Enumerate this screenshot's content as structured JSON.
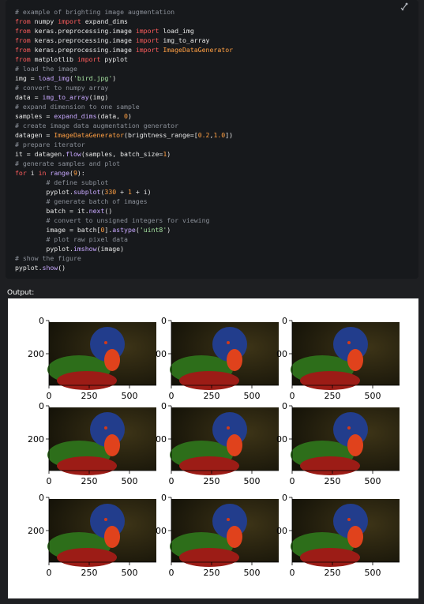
{
  "code": {
    "lines": [
      [
        {
          "t": "# example of brighting image augmentation",
          "c": "comment"
        }
      ],
      [
        {
          "t": "from",
          "c": "keyword"
        },
        {
          "t": " numpy ",
          "c": "default"
        },
        {
          "t": "import",
          "c": "keyword"
        },
        {
          "t": " expand_dims",
          "c": "default"
        }
      ],
      [
        {
          "t": "from",
          "c": "keyword"
        },
        {
          "t": " keras.preprocessing.image ",
          "c": "default"
        },
        {
          "t": "import",
          "c": "keyword"
        },
        {
          "t": " load_img",
          "c": "default"
        }
      ],
      [
        {
          "t": "from",
          "c": "keyword"
        },
        {
          "t": " keras.preprocessing.image ",
          "c": "default"
        },
        {
          "t": "import",
          "c": "keyword"
        },
        {
          "t": " img_to_array",
          "c": "default"
        }
      ],
      [
        {
          "t": "from",
          "c": "keyword"
        },
        {
          "t": " keras.preprocessing.image ",
          "c": "default"
        },
        {
          "t": "import",
          "c": "keyword"
        },
        {
          "t": " ImageDataGenerator",
          "c": "class"
        }
      ],
      [
        {
          "t": "from",
          "c": "keyword"
        },
        {
          "t": " matplotlib ",
          "c": "default"
        },
        {
          "t": "import",
          "c": "keyword"
        },
        {
          "t": " pyplot",
          "c": "default"
        }
      ],
      [
        {
          "t": "# load the image",
          "c": "comment"
        }
      ],
      [
        {
          "t": "img = ",
          "c": "default"
        },
        {
          "t": "load_img",
          "c": "function"
        },
        {
          "t": "(",
          "c": "default"
        },
        {
          "t": "'bird.jpg'",
          "c": "string"
        },
        {
          "t": ")",
          "c": "default"
        }
      ],
      [
        {
          "t": "# convert to numpy array",
          "c": "comment"
        }
      ],
      [
        {
          "t": "data = ",
          "c": "default"
        },
        {
          "t": "img_to_array",
          "c": "function"
        },
        {
          "t": "(img)",
          "c": "default"
        }
      ],
      [
        {
          "t": "# expand dimension to one sample",
          "c": "comment"
        }
      ],
      [
        {
          "t": "samples = ",
          "c": "default"
        },
        {
          "t": "expand_dims",
          "c": "function"
        },
        {
          "t": "(data, ",
          "c": "default"
        },
        {
          "t": "0",
          "c": "number"
        },
        {
          "t": ")",
          "c": "default"
        }
      ],
      [
        {
          "t": "# create image data augmentation generator",
          "c": "comment"
        }
      ],
      [
        {
          "t": "datagen = ",
          "c": "default"
        },
        {
          "t": "ImageDataGenerator",
          "c": "class"
        },
        {
          "t": "(brightness_range=[",
          "c": "default"
        },
        {
          "t": "0.2",
          "c": "number"
        },
        {
          "t": ",",
          "c": "default"
        },
        {
          "t": "1.0",
          "c": "number"
        },
        {
          "t": "])",
          "c": "default"
        }
      ],
      [
        {
          "t": "# prepare iterator",
          "c": "comment"
        }
      ],
      [
        {
          "t": "it = datagen.",
          "c": "default"
        },
        {
          "t": "flow",
          "c": "function"
        },
        {
          "t": "(samples, batch_size=",
          "c": "default"
        },
        {
          "t": "1",
          "c": "number"
        },
        {
          "t": ")",
          "c": "default"
        }
      ],
      [
        {
          "t": "# generate samples and plot",
          "c": "comment"
        }
      ],
      [
        {
          "t": "for",
          "c": "keyword"
        },
        {
          "t": " i ",
          "c": "default"
        },
        {
          "t": "in",
          "c": "keyword"
        },
        {
          "t": " ",
          "c": "default"
        },
        {
          "t": "range",
          "c": "function"
        },
        {
          "t": "(",
          "c": "default"
        },
        {
          "t": "9",
          "c": "number"
        },
        {
          "t": "):",
          "c": "default"
        }
      ],
      [
        {
          "t": "        ",
          "c": "default"
        },
        {
          "t": "# define subplot",
          "c": "comment"
        }
      ],
      [
        {
          "t": "        pyplot.",
          "c": "default"
        },
        {
          "t": "subplot",
          "c": "function"
        },
        {
          "t": "(",
          "c": "default"
        },
        {
          "t": "330",
          "c": "number"
        },
        {
          "t": " + ",
          "c": "default"
        },
        {
          "t": "1",
          "c": "number"
        },
        {
          "t": " + i)",
          "c": "default"
        }
      ],
      [
        {
          "t": "        ",
          "c": "default"
        },
        {
          "t": "# generate batch of images",
          "c": "comment"
        }
      ],
      [
        {
          "t": "        batch = it.",
          "c": "default"
        },
        {
          "t": "next",
          "c": "function"
        },
        {
          "t": "()",
          "c": "default"
        }
      ],
      [
        {
          "t": "        ",
          "c": "default"
        },
        {
          "t": "# convert to unsigned integers for viewing",
          "c": "comment"
        }
      ],
      [
        {
          "t": "        image = batch[",
          "c": "default"
        },
        {
          "t": "0",
          "c": "number"
        },
        {
          "t": "].",
          "c": "default"
        },
        {
          "t": "astype",
          "c": "function"
        },
        {
          "t": "(",
          "c": "default"
        },
        {
          "t": "'uint8'",
          "c": "string"
        },
        {
          "t": ")",
          "c": "default"
        }
      ],
      [
        {
          "t": "        ",
          "c": "default"
        },
        {
          "t": "# plot raw pixel data",
          "c": "comment"
        }
      ],
      [
        {
          "t": "        pyplot.",
          "c": "default"
        },
        {
          "t": "imshow",
          "c": "function"
        },
        {
          "t": "(image)",
          "c": "default"
        }
      ],
      [
        {
          "t": "# show the figure",
          "c": "comment"
        }
      ],
      [
        {
          "t": "pyplot.",
          "c": "default"
        },
        {
          "t": "show",
          "c": "function"
        },
        {
          "t": "()",
          "c": "default"
        }
      ]
    ]
  },
  "copy_icon": "copy-icon",
  "output_label": "Output:",
  "colors": {
    "comment": "#8a8f98",
    "keyword": "#ff5c5c",
    "function": "#c8a8ff",
    "class": "#ff9f43",
    "string": "#a6e3a1",
    "number": "#ff9f43",
    "default": "#e6e6e6"
  },
  "subplots": {
    "rows": 3,
    "cols": 3,
    "x_ticks": [
      "0",
      "250",
      "500"
    ],
    "y_ticks_left": [
      "0",
      "200"
    ],
    "y_ticks_inner": [
      "0",
      "00"
    ]
  }
}
